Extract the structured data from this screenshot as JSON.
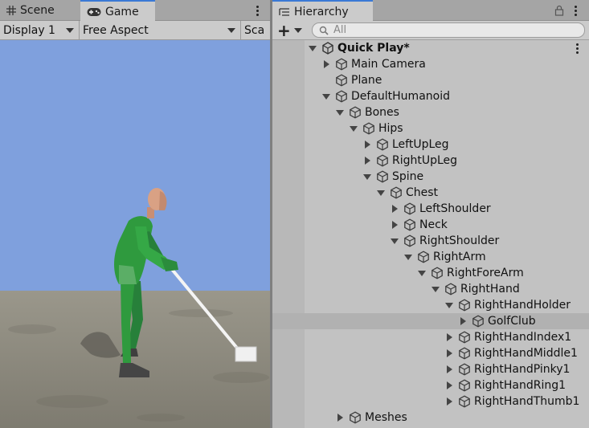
{
  "game_window": {
    "tabs": [
      {
        "label": "Scene",
        "icon": "grid-icon",
        "active": false
      },
      {
        "label": "Game",
        "icon": "gamepad-icon",
        "active": true
      }
    ],
    "toolbar": {
      "display": "Display 1",
      "aspect": "Free Aspect",
      "scale": "Sca"
    },
    "colors": {
      "sky": "#7fa0dd",
      "ground": "#8d897c",
      "character": "#2f9a3e",
      "skin": "#d9a184"
    }
  },
  "hierarchy": {
    "tab_label": "Hierarchy",
    "add_label": "+",
    "search_placeholder": "All",
    "scene_name": "Quick Play*",
    "items": [
      {
        "label": "Main Camera",
        "depth": 0,
        "fold": "closed"
      },
      {
        "label": "Plane",
        "depth": 0,
        "fold": "none"
      },
      {
        "label": "DefaultHumanoid",
        "depth": 0,
        "fold": "open"
      },
      {
        "label": "Bones",
        "depth": 1,
        "fold": "open"
      },
      {
        "label": "Hips",
        "depth": 2,
        "fold": "open"
      },
      {
        "label": "LeftUpLeg",
        "depth": 3,
        "fold": "closed"
      },
      {
        "label": "RightUpLeg",
        "depth": 3,
        "fold": "closed"
      },
      {
        "label": "Spine",
        "depth": 3,
        "fold": "open"
      },
      {
        "label": "Chest",
        "depth": 4,
        "fold": "open"
      },
      {
        "label": "LeftShoulder",
        "depth": 5,
        "fold": "closed"
      },
      {
        "label": "Neck",
        "depth": 5,
        "fold": "closed"
      },
      {
        "label": "RightShoulder",
        "depth": 5,
        "fold": "open"
      },
      {
        "label": "RightArm",
        "depth": 6,
        "fold": "open"
      },
      {
        "label": "RightForeArm",
        "depth": 7,
        "fold": "open"
      },
      {
        "label": "RightHand",
        "depth": 8,
        "fold": "open"
      },
      {
        "label": "RightHandHolder",
        "depth": 9,
        "fold": "open"
      },
      {
        "label": "GolfClub",
        "depth": 10,
        "fold": "closed",
        "selected": true
      },
      {
        "label": "RightHandIndex1",
        "depth": 9,
        "fold": "closed"
      },
      {
        "label": "RightHandMiddle1",
        "depth": 9,
        "fold": "closed"
      },
      {
        "label": "RightHandPinky1",
        "depth": 9,
        "fold": "closed"
      },
      {
        "label": "RightHandRing1",
        "depth": 9,
        "fold": "closed"
      },
      {
        "label": "RightHandThumb1",
        "depth": 9,
        "fold": "closed"
      },
      {
        "label": "Meshes",
        "depth": 1,
        "fold": "closed"
      }
    ]
  }
}
